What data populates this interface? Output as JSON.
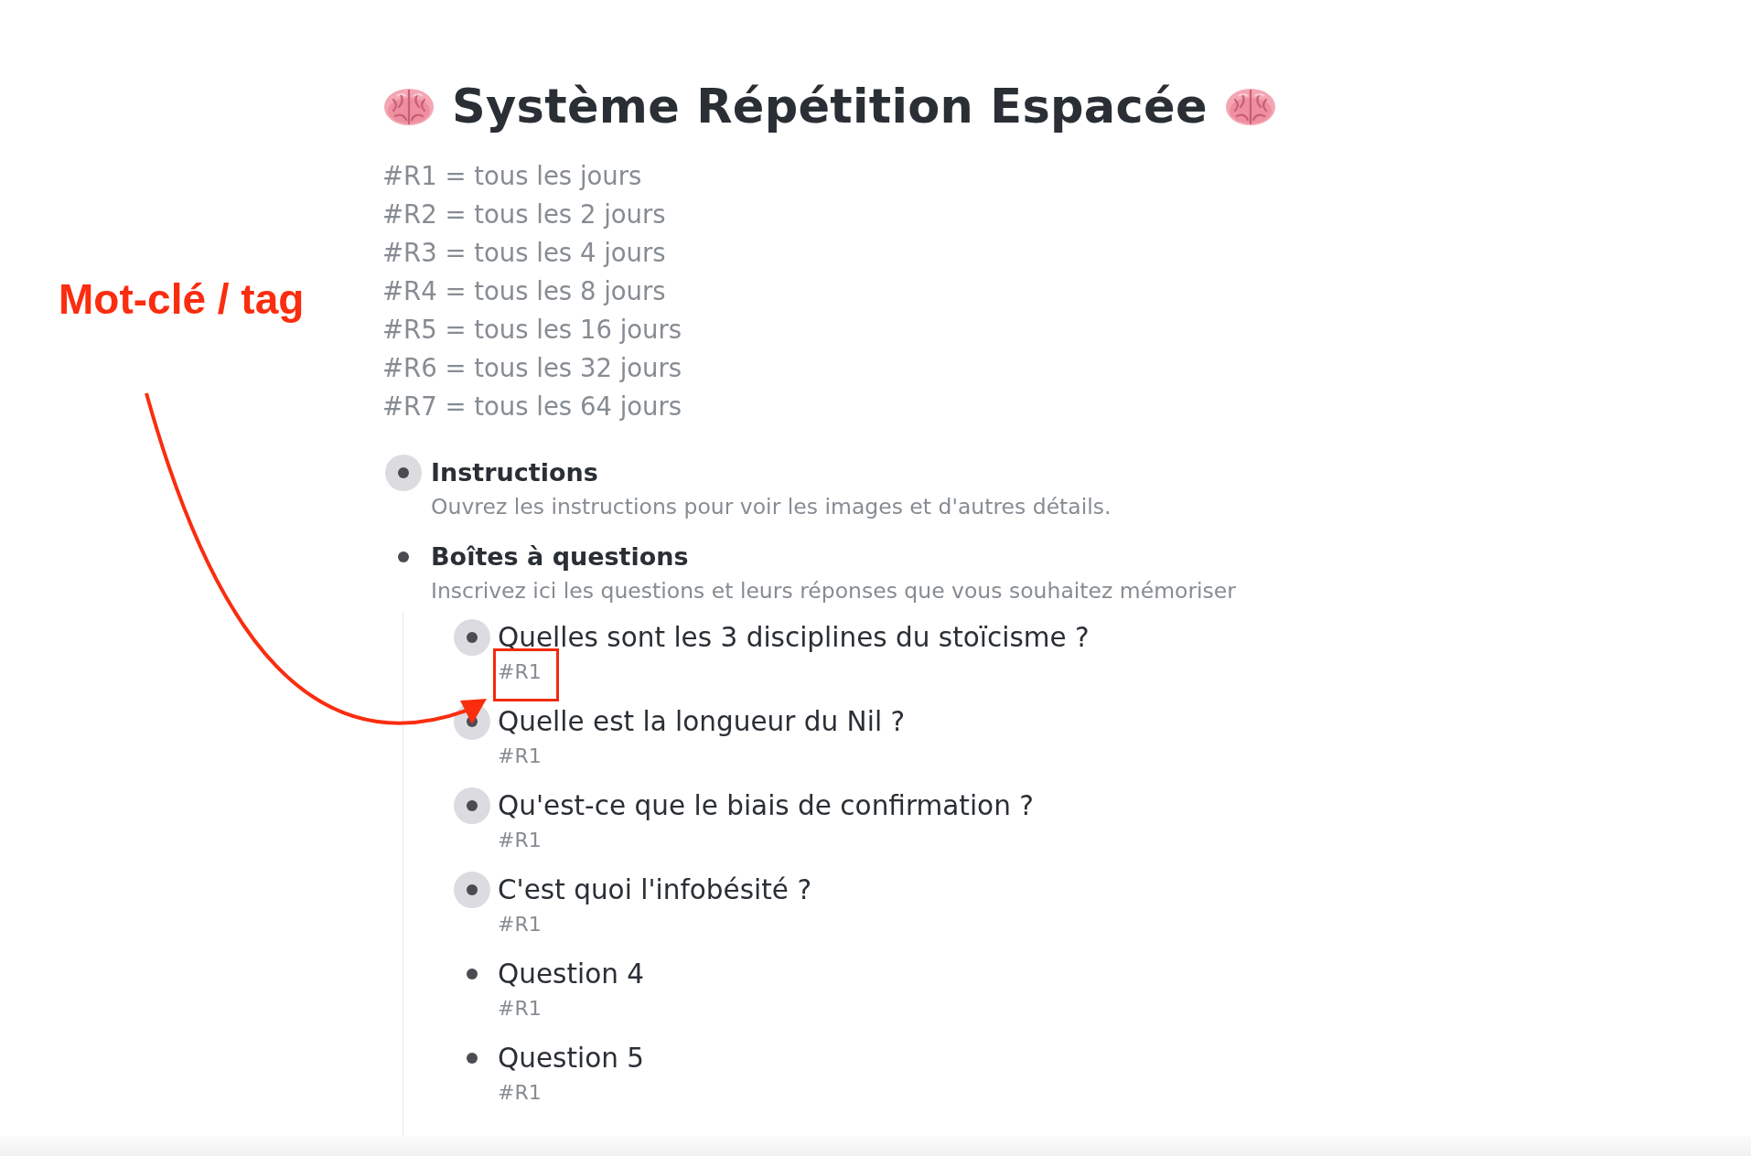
{
  "title": "Système Répétition Espacée",
  "legend": [
    "#R1 = tous les jours",
    "#R2 = tous les 2 jours",
    "#R3 = tous les 4 jours",
    "#R4 = tous les 8 jours",
    "#R5 = tous les 16 jours",
    "#R6 = tous les 32 jours",
    "#R7 = tous les 64 jours"
  ],
  "items": [
    {
      "text": "Instructions",
      "note": "Ouvrez les instructions pour voir les images et d'autres détails.",
      "collapsed": true
    },
    {
      "text": "Boîtes à questions",
      "note": "Inscrivez ici les questions et leurs réponses que vous souhaitez mémoriser",
      "collapsed": false,
      "children": [
        {
          "text": "Quelles sont les 3 disciplines du stoïcisme ?",
          "tag": "#R1",
          "collapsed": true,
          "highlighted": true
        },
        {
          "text": "Quelle est la longueur du Nil ?",
          "tag": "#R1",
          "collapsed": true,
          "highlighted": false
        },
        {
          "text": "Qu'est-ce que le biais de confirmation ?",
          "tag": "#R1",
          "collapsed": true,
          "highlighted": false
        },
        {
          "text": "C'est quoi l'infobésité ?",
          "tag": "#R1",
          "collapsed": true,
          "highlighted": false
        },
        {
          "text": "Question 4",
          "tag": "#R1",
          "collapsed": false,
          "highlighted": false
        },
        {
          "text": "Question 5",
          "tag": "#R1",
          "collapsed": false,
          "highlighted": false
        }
      ]
    }
  ],
  "annotation": {
    "label": "Mot-clé / tag"
  }
}
